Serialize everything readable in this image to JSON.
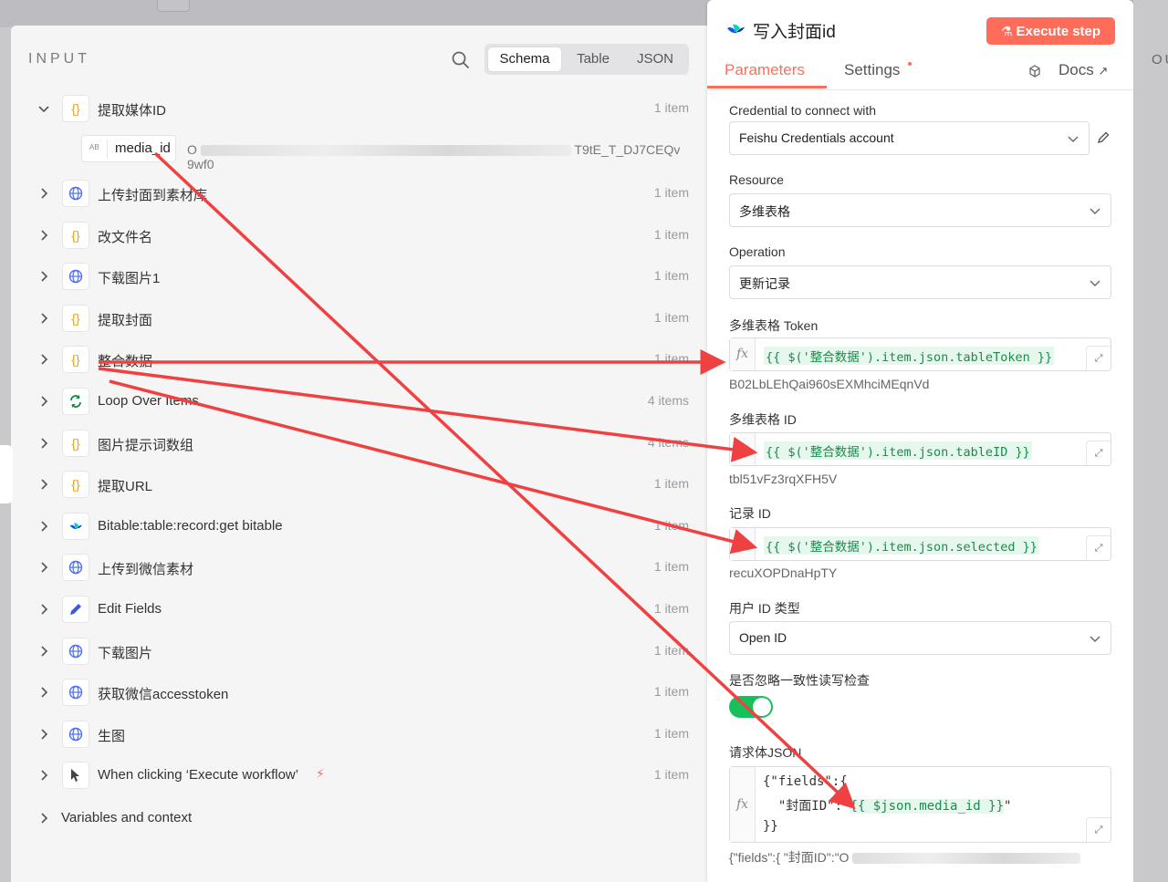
{
  "background": {
    "accent": "#ff6d5a"
  },
  "input_panel": {
    "title": "INPUT",
    "view_tabs": [
      "Schema",
      "Table",
      "JSON"
    ],
    "active_tab": "Schema",
    "expanded_node": {
      "label": "提取媒体ID",
      "count": "1 item",
      "field": {
        "type_badge": "AB",
        "name": "media_id",
        "value_start": "O",
        "value_end": "T9tE_T_DJ7CEQv",
        "value_line2": "9wf0"
      }
    },
    "nodes": [
      {
        "label": "上传封面到素材库",
        "count": "1 item",
        "icon": "globe-icon"
      },
      {
        "label": "改文件名",
        "count": "1 item",
        "icon": "braces-icon"
      },
      {
        "label": "下载图片1",
        "count": "1 item",
        "icon": "globe-icon"
      },
      {
        "label": "提取封面",
        "count": "1 item",
        "icon": "braces-icon"
      },
      {
        "label": "整合数据",
        "count": "1 item",
        "icon": "braces-icon"
      },
      {
        "label": "Loop Over Items",
        "count": "4 items",
        "icon": "loop-icon"
      },
      {
        "label": "图片提示词数组",
        "count": "4 items",
        "icon": "braces-icon"
      },
      {
        "label": "提取URL",
        "count": "1 item",
        "icon": "braces-icon"
      },
      {
        "label": "Bitable:table:record:get bitable",
        "count": "1 item",
        "icon": "feishu-icon"
      },
      {
        "label": "上传到微信素材",
        "count": "1 item",
        "icon": "globe-icon"
      },
      {
        "label": "Edit Fields",
        "count": "1 item",
        "icon": "pencil-icon"
      },
      {
        "label": "下载图片",
        "count": "1 item",
        "icon": "globe-icon"
      },
      {
        "label": "获取微信accesstoken",
        "count": "1 item",
        "icon": "globe-icon"
      },
      {
        "label": "生图",
        "count": "1 item",
        "icon": "globe-icon"
      },
      {
        "label": "When clicking ‘Execute workflow’",
        "count": "1 item",
        "icon": "cursor-icon"
      }
    ],
    "variables_label": "Variables and context"
  },
  "params_panel": {
    "title": "写入封面id",
    "execute_label": "Execute step",
    "tabs": {
      "parameters": "Parameters",
      "settings": "Settings",
      "docs": "Docs"
    },
    "credential_label": "Credential to connect with",
    "credential_value": "Feishu Credentials account",
    "resource_label": "Resource",
    "resource_value": "多维表格",
    "operation_label": "Operation",
    "operation_value": "更新记录",
    "token_label": "多维表格 Token",
    "token_expr": "{{ $('整合数据').item.json.tableToken }}",
    "token_result": "B02LbLEhQai960sEXMhciMEqnVd",
    "tableid_label": "多维表格 ID",
    "tableid_expr": "{{ $('整合数据').item.json.tableID }}",
    "tableid_result": "tbl51vFz3rqXFH5V",
    "record_label": "记录 ID",
    "record_expr": "{{ $('整合数据').item.json.selected }}",
    "record_result": "recuXOPDnaHpTY",
    "userid_label": "用户 ID 类型",
    "userid_value": "Open ID",
    "ignore_label": "是否忽略一致性读写检查",
    "ignore_on": true,
    "json_label": "请求体JSON",
    "json_line1": "{\"fields\":{",
    "json_line2_key": "  \"封面ID\":\"",
    "json_line2_expr": "{{ $json.media_id }}",
    "json_line2_end": "\"",
    "json_line3": "}}",
    "json_result": "{\"fields\":{  \"封面ID\":\"O"
  },
  "right_strip": {
    "label": "OU"
  }
}
